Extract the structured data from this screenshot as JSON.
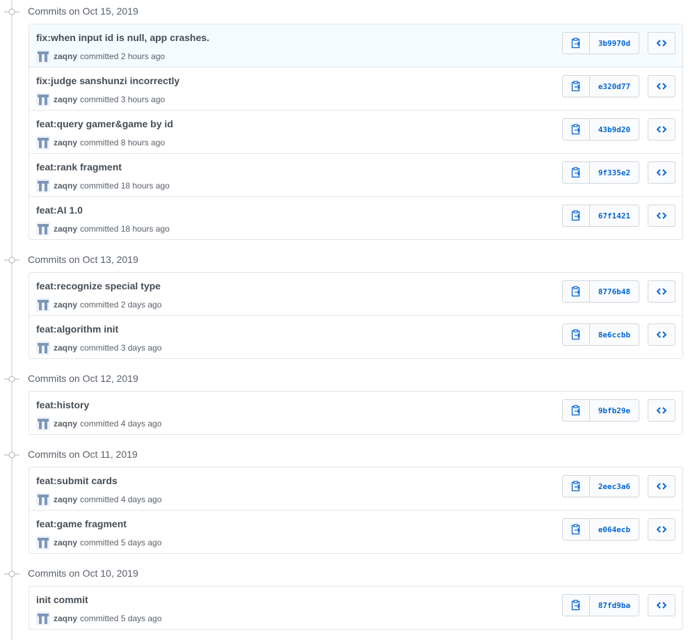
{
  "colors": {
    "link": "#0366d6",
    "border": "#e1e4e8",
    "muted": "#586069",
    "highlight": "#f6fbff"
  },
  "icons": {
    "group": "git-commit-icon",
    "copy": "clipboard-icon",
    "browse": "code-icon",
    "avatar": "user-avatar-icon"
  },
  "groups": [
    {
      "title": "Commits on Oct 15, 2019",
      "commits": [
        {
          "message": "fix:when input id is null, app crashes.",
          "author": "zaqny",
          "when": "committed 2 hours ago",
          "sha": "3b9970d"
        },
        {
          "message": "fix:judge sanshunzi incorrectly",
          "author": "zaqny",
          "when": "committed 3 hours ago",
          "sha": "e320d77"
        },
        {
          "message": "feat:query gamer&game by id",
          "author": "zaqny",
          "when": "committed 8 hours ago",
          "sha": "43b9d20"
        },
        {
          "message": "feat:rank fragment",
          "author": "zaqny",
          "when": "committed 18 hours ago",
          "sha": "9f335e2"
        },
        {
          "message": "feat:AI 1.0",
          "author": "zaqny",
          "when": "committed 18 hours ago",
          "sha": "67f1421"
        }
      ]
    },
    {
      "title": "Commits on Oct 13, 2019",
      "commits": [
        {
          "message": "feat:recognize special type",
          "author": "zaqny",
          "when": "committed 2 days ago",
          "sha": "8776b48"
        },
        {
          "message": "feat:algorithm init",
          "author": "zaqny",
          "when": "committed 3 days ago",
          "sha": "8e6ccbb"
        }
      ]
    },
    {
      "title": "Commits on Oct 12, 2019",
      "commits": [
        {
          "message": "feat:history",
          "author": "zaqny",
          "when": "committed 4 days ago",
          "sha": "9bfb29e"
        }
      ]
    },
    {
      "title": "Commits on Oct 11, 2019",
      "commits": [
        {
          "message": "feat:submit cards",
          "author": "zaqny",
          "when": "committed 4 days ago",
          "sha": "2eec3a6"
        },
        {
          "message": "feat:game fragment",
          "author": "zaqny",
          "when": "committed 5 days ago",
          "sha": "e064ecb"
        }
      ]
    },
    {
      "title": "Commits on Oct 10, 2019",
      "commits": [
        {
          "message": "init commit",
          "author": "zaqny",
          "when": "committed 5 days ago",
          "sha": "87fd9ba"
        }
      ]
    }
  ]
}
